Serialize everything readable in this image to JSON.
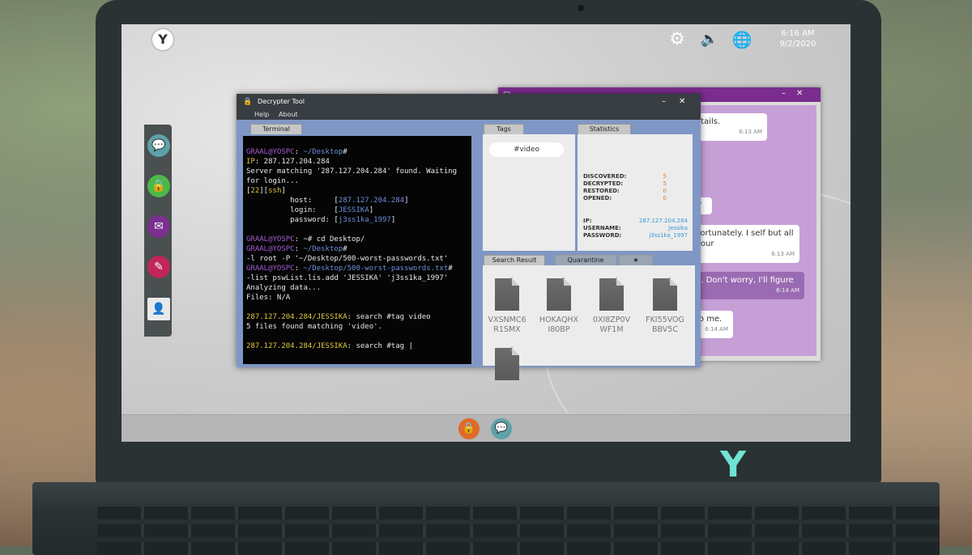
{
  "topbar": {
    "logo": "Y",
    "icons": [
      "gear-icon",
      "speaker-icon",
      "globe-icon"
    ],
    "time": "6:16 AM",
    "date": "9/2/2020"
  },
  "dock_left": [
    "chat-icon",
    "lock-icon",
    "mail-icon",
    "notes-icon",
    "contact-icon"
  ],
  "taskbar": [
    "lock-icon",
    "chat-icon"
  ],
  "chat": {
    "messages": [
      {
        "text": "etails.",
        "time": "6:13 AM",
        "me": false
      },
      {
        "text": "Fortunately. I self but all your",
        "time": "6:13 AM",
        "me": false
      },
      {
        "text": "d. Don't worry, I'll figure",
        "time": "6:14 AM",
        "me": true
      },
      {
        "text": "to me.",
        "time": "6:14 AM",
        "me": false
      }
    ],
    "partial_link": "7"
  },
  "decrypter": {
    "title": "Decrypter Tool",
    "menu": [
      "Help",
      "About"
    ],
    "tabs": {
      "terminal": "Terminal",
      "tags": "Tags",
      "statistics": "Statistics",
      "search": "Search Result",
      "quarantine": "Quarantine",
      "star": "★"
    },
    "terminal_lines": [
      {
        "parts": [
          {
            "t": "GRAAL@YOSPC",
            "c": "purple"
          },
          {
            "t": ": ",
            "c": ""
          },
          {
            "t": "~/Desktop",
            "c": "blue"
          },
          {
            "t": "#",
            "c": ""
          }
        ]
      },
      {
        "parts": [
          {
            "t": "IP",
            "c": "yellow"
          },
          {
            "t": ": 287.127.204.284",
            "c": ""
          }
        ]
      },
      {
        "parts": [
          {
            "t": "Server matching '287.127.204.284' found. Waiting",
            "c": ""
          }
        ]
      },
      {
        "parts": [
          {
            "t": "for login...",
            "c": ""
          }
        ]
      },
      {
        "parts": [
          {
            "t": "[",
            "c": ""
          },
          {
            "t": "22",
            "c": "yellow"
          },
          {
            "t": "][",
            "c": ""
          },
          {
            "t": "ssh",
            "c": "yellow"
          },
          {
            "t": "]",
            "c": ""
          }
        ]
      },
      {
        "parts": [
          {
            "t": "          host:     [",
            "c": ""
          },
          {
            "t": "287.127.204.284",
            "c": "blue"
          },
          {
            "t": "]",
            "c": ""
          }
        ]
      },
      {
        "parts": [
          {
            "t": "          login:    [",
            "c": ""
          },
          {
            "t": "JESSIKA",
            "c": "blue"
          },
          {
            "t": "]",
            "c": ""
          }
        ]
      },
      {
        "parts": [
          {
            "t": "          password: [",
            "c": ""
          },
          {
            "t": "j3ss1ka_1997",
            "c": "blue"
          },
          {
            "t": "]",
            "c": ""
          }
        ]
      },
      {
        "parts": [
          {
            "t": "",
            "c": ""
          }
        ]
      },
      {
        "parts": [
          {
            "t": "GRAAL@YOSPC",
            "c": "purple"
          },
          {
            "t": ": ~# cd Desktop/",
            "c": ""
          }
        ]
      },
      {
        "parts": [
          {
            "t": "GRAAL@YOSPC",
            "c": "purple"
          },
          {
            "t": ": ",
            "c": ""
          },
          {
            "t": "~/Desktop",
            "c": "blue"
          },
          {
            "t": "#",
            "c": ""
          }
        ]
      },
      {
        "parts": [
          {
            "t": "-l root -P '~/Desktop/500-worst-passwords.txt'",
            "c": ""
          }
        ]
      },
      {
        "parts": [
          {
            "t": "GRAAL@YOSPC",
            "c": "purple"
          },
          {
            "t": ": ",
            "c": ""
          },
          {
            "t": "~/Desktop/500-worst-passwords.txt",
            "c": "blue"
          },
          {
            "t": "#",
            "c": ""
          }
        ]
      },
      {
        "parts": [
          {
            "t": "-list pswList.lis.add 'JESSIKA' 'j3ss1ka_1997'",
            "c": ""
          }
        ]
      },
      {
        "parts": [
          {
            "t": "Analyzing data...",
            "c": ""
          }
        ]
      },
      {
        "parts": [
          {
            "t": "Files: N/A",
            "c": ""
          }
        ]
      },
      {
        "parts": [
          {
            "t": "",
            "c": ""
          }
        ]
      },
      {
        "parts": [
          {
            "t": "287.127.204.284/JESSIKA",
            "c": "yellow"
          },
          {
            "t": ": search #tag video",
            "c": ""
          }
        ]
      },
      {
        "parts": [
          {
            "t": "5 files found matching 'video'.",
            "c": ""
          }
        ]
      },
      {
        "parts": [
          {
            "t": "",
            "c": ""
          }
        ]
      },
      {
        "parts": [
          {
            "t": "287.127.204.284/JESSIKA",
            "c": "yellow"
          },
          {
            "t": ": search #tag |",
            "c": ""
          }
        ]
      }
    ],
    "tag": "#video",
    "stats": [
      {
        "label": "DISCOVERED:",
        "value": "5"
      },
      {
        "label": "DECRYPTED:",
        "value": "5"
      },
      {
        "label": "RESTORED:",
        "value": "0"
      },
      {
        "label": "OPENED:",
        "value": "0"
      }
    ],
    "info": [
      {
        "label": "IP:",
        "value": "287.127.204.284"
      },
      {
        "label": "USERNAME:",
        "value": "Jessika"
      },
      {
        "label": "PASSWORD:",
        "value": "j3ss1ka_1997"
      }
    ],
    "files": [
      {
        "l1": "VXSNMC6",
        "l2": "R1SMX"
      },
      {
        "l1": "HOKAQHX",
        "l2": "I80BP"
      },
      {
        "l1": "0XI8ZP0V",
        "l2": "WF1M"
      },
      {
        "l1": "FKI55VOG",
        "l2": "BBV5C"
      },
      {
        "l1": "",
        "l2": ""
      }
    ]
  }
}
